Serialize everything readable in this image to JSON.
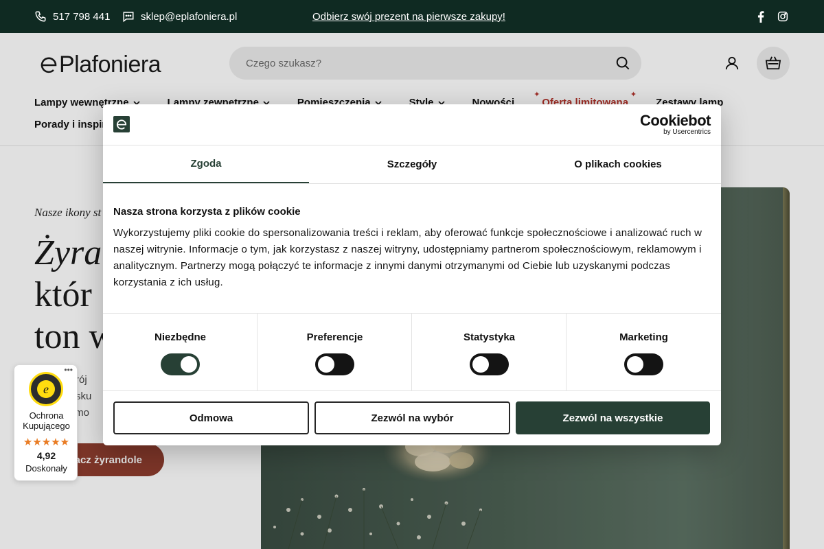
{
  "topbar": {
    "phone": "517 798 441",
    "email": "sklep@eplafoniera.pl",
    "promo": "Odbierz swój prezent na pierwsze zakupy!",
    "social": [
      "facebook-icon",
      "instagram-icon"
    ]
  },
  "header": {
    "logo_text": "Plafoniera",
    "search_placeholder": "Czego szukasz?",
    "icons": [
      "search-icon",
      "account-icon",
      "cart-icon"
    ]
  },
  "nav": {
    "row1": [
      "Lampy wewnętrzne",
      "Lampy zewnętrzne",
      "Pomieszczenia",
      "Style",
      "Nowości",
      "Oferta limitowana",
      "Zestawy lamp"
    ],
    "row2": [
      "Porady i inspir"
    ]
  },
  "hero": {
    "subtitle": "Nasze ikony st",
    "title_line1": "Żyra",
    "title_line2": "któr",
    "title_line3": "ton w",
    "desc_line1": "astrój",
    "desc_line2": "blasku",
    "desc_line3": "i z mo",
    "button": "acz żyrandole"
  },
  "cookie_dialog": {
    "brand": "Cookiebot",
    "brand_by": "by Usercentrics",
    "tabs": [
      "Zgoda",
      "Szczegóły",
      "O plikach cookies"
    ],
    "heading": "Nasza strona korzysta z plików cookie",
    "body": "Wykorzystujemy pliki cookie do spersonalizowania treści i reklam, aby oferować funkcje społecznościowe i analizować ruch w naszej witrynie. Informacje o tym, jak korzystasz z naszej witryny, udostępniamy partnerom społecznościowym, reklamowym i analitycznym. Partnerzy mogą połączyć te informacje z innymi danymi otrzymanymi od Ciebie lub uzyskanymi podczas korzystania z ich usług.",
    "toggles": [
      {
        "label": "Niezbędne",
        "on": true
      },
      {
        "label": "Preferencje",
        "on": false
      },
      {
        "label": "Statystyka",
        "on": false
      },
      {
        "label": "Marketing",
        "on": false
      }
    ],
    "buttons": {
      "deny": "Odmowa",
      "allow_selection": "Zezwól na wybór",
      "allow_all": "Zezwól na wszystkie"
    }
  },
  "trusted_shops": {
    "line1": "Ochrona",
    "line2": "Kupującego",
    "stars": "★★★★★",
    "rating": "4,92",
    "verdict": "Doskonały"
  },
  "colors": {
    "topbar_bg": "#0f2a22",
    "accent_green": "#274035",
    "accent_red": "#b3332b",
    "hero_button": "#8e3d2e",
    "star_orange": "#e97c24"
  }
}
